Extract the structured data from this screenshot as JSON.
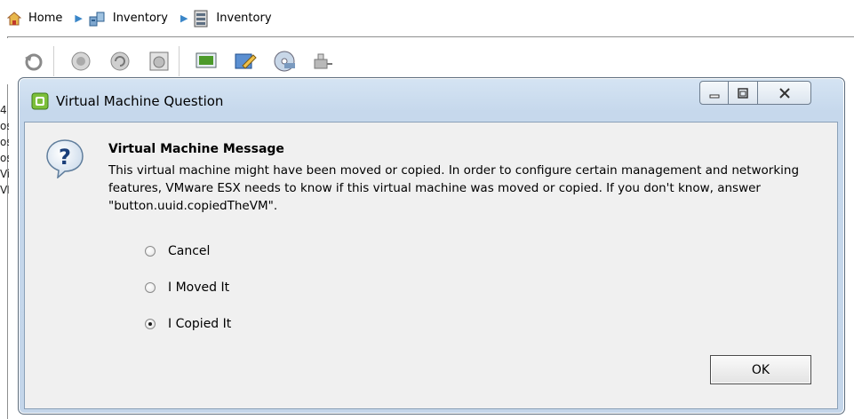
{
  "breadcrumb": {
    "items": [
      {
        "label": "Home"
      },
      {
        "label": "Inventory"
      },
      {
        "label": "Inventory"
      }
    ]
  },
  "toolbar": {
    "icons": [
      "refresh-icon",
      "snapshot-icon",
      "revert-snapshot-icon",
      "snapshot-manager-icon",
      "console-icon",
      "edit-settings-icon",
      "cd-drive-icon",
      "network-icon"
    ]
  },
  "side_list": [
    "4",
    "os",
    "os",
    "os",
    "Vi",
    "VI"
  ],
  "dialog": {
    "title": "Virtual Machine Question",
    "heading": "Virtual Machine Message",
    "body": "This virtual machine might have been moved or copied. In order to configure certain management and networking features, VMware ESX needs to know if this virtual machine was moved or copied. If you don't know, answer \"button.uuid.copiedTheVM\".",
    "options": [
      {
        "label": "Cancel",
        "selected": false
      },
      {
        "label": "I Moved It",
        "selected": false
      },
      {
        "label": "I Copied It",
        "selected": true
      }
    ],
    "ok_label": "OK"
  },
  "colors": {
    "accent": "#3a86c8",
    "title_gradient_top": "#d5e4f3",
    "client_background": "#f0f0f0"
  }
}
